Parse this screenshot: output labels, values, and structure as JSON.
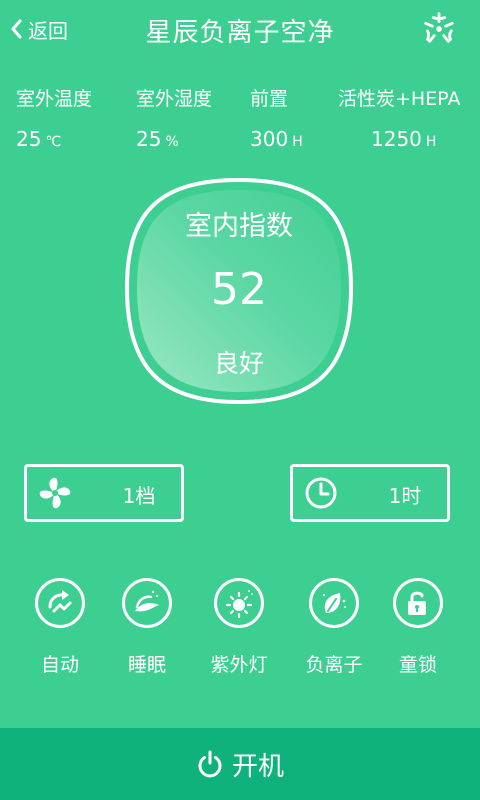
{
  "header": {
    "back_label": "返回",
    "title": "星辰负离子空净",
    "logo_icon": "star-burst-logo"
  },
  "stats": [
    {
      "label": "室外温度",
      "value": "25",
      "unit": "℃"
    },
    {
      "label": "室外湿度",
      "value": "25",
      "unit": "%"
    },
    {
      "label": "前置",
      "value": "300",
      "unit": "H"
    },
    {
      "label": "活性炭+HEPA",
      "value": "1250",
      "unit": "H"
    }
  ],
  "gauge": {
    "label": "室内指数",
    "value": "52",
    "status": "良好"
  },
  "controls": {
    "fan": {
      "icon": "fan-icon",
      "label": "1档"
    },
    "timer": {
      "icon": "clock-icon",
      "label": "1时"
    }
  },
  "modes": [
    {
      "icon": "auto-icon",
      "label": "自动"
    },
    {
      "icon": "sleep-icon",
      "label": "睡眠"
    },
    {
      "icon": "uv-light-icon",
      "label": "紫外灯"
    },
    {
      "icon": "anion-icon",
      "label": "负离子"
    },
    {
      "icon": "child-lock-icon",
      "label": "童锁"
    }
  ],
  "power": {
    "icon": "power-icon",
    "label": "开机"
  },
  "colors": {
    "background": "#3dcf92",
    "power_bar": "#10b27b",
    "text": "#ffffff"
  }
}
